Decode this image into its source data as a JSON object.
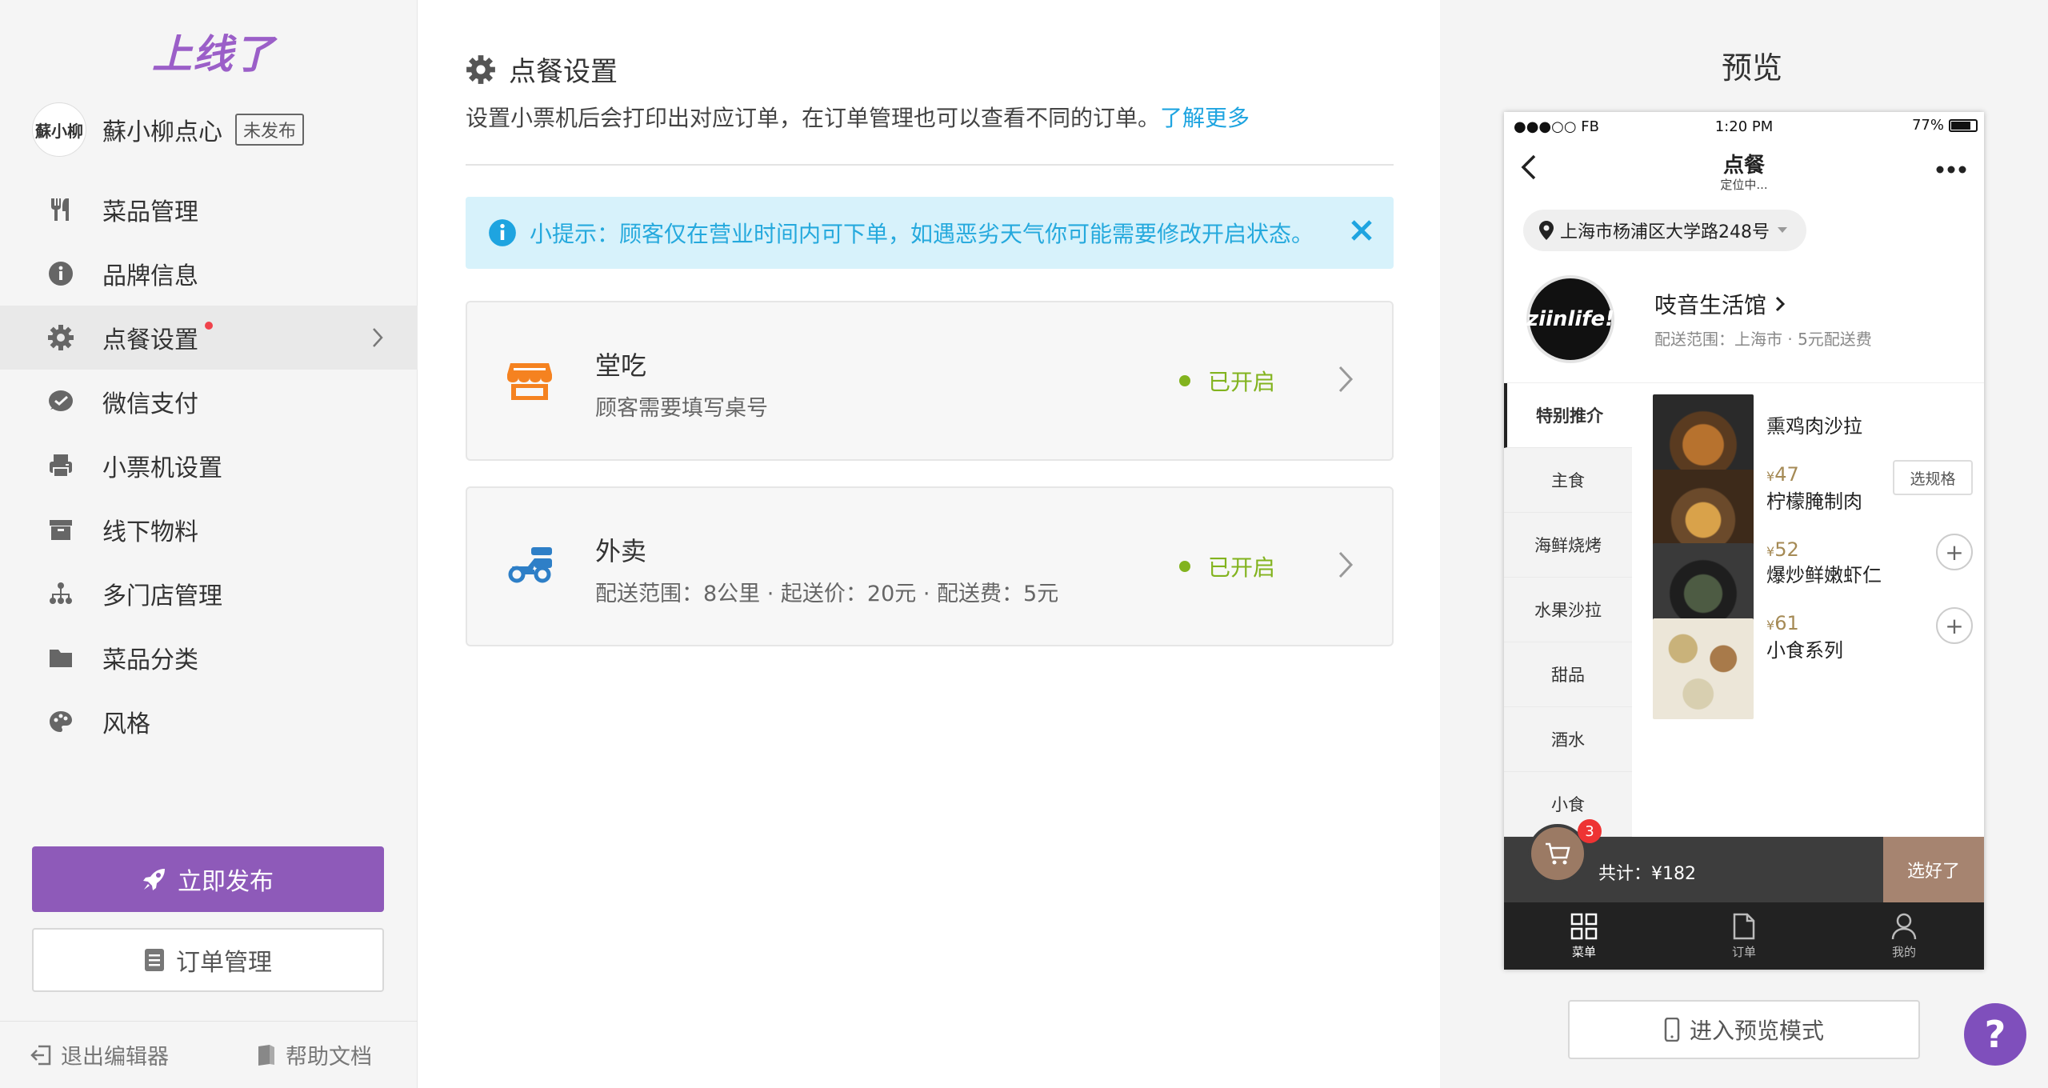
{
  "app": {
    "logo_text": "上线了"
  },
  "store": {
    "avatar_text": "蘇小柳",
    "name": "蘇小柳点心",
    "status_badge": "未发布"
  },
  "sidebar": {
    "items": [
      {
        "label": "菜品管理",
        "icon": "utensils-icon"
      },
      {
        "label": "品牌信息",
        "icon": "info-icon"
      },
      {
        "label": "点餐设置",
        "icon": "gear-icon",
        "active": true,
        "has_dot": true
      },
      {
        "label": "微信支付",
        "icon": "wechat-pay-icon"
      },
      {
        "label": "小票机设置",
        "icon": "printer-icon"
      },
      {
        "label": "线下物料",
        "icon": "archive-icon"
      },
      {
        "label": "多门店管理",
        "icon": "sitemap-icon"
      },
      {
        "label": "菜品分类",
        "icon": "folder-icon"
      },
      {
        "label": "风格",
        "icon": "palette-icon"
      }
    ],
    "publish_label": "立即发布",
    "orders_label": "订单管理",
    "exit_label": "退出编辑器",
    "help_label": "帮助文档"
  },
  "main": {
    "title": "点餐设置",
    "description": "设置小票机后会打印出对应订单，在订单管理也可以查看不同的订单。",
    "learn_more": "了解更多",
    "tip": "小提示：顾客仅在营业时间内可下单，如遇恶劣天气你可能需要修改开启状态。",
    "cards": [
      {
        "title": "堂吃",
        "subtitle": "顾客需要填写桌号",
        "status": "已开启",
        "icon": "store-icon"
      },
      {
        "title": "外卖",
        "subtitle": "配送范围：8公里 · 起送价：20元 · 配送费：5元",
        "status": "已开启",
        "icon": "scooter-icon"
      }
    ]
  },
  "preview": {
    "title": "预览",
    "statusbar": {
      "carrier": "●●●○○ FB",
      "time": "1:20 PM",
      "battery": "77%"
    },
    "nav_title": "点餐",
    "nav_subtitle": "定位中...",
    "address": "上海市杨浦区大学路248号",
    "shop": {
      "logo_text": "ziinlife!",
      "name": "吱音生活馆",
      "subtitle": "配送范围：上海市 · 5元配送费"
    },
    "categories": [
      "特别推介",
      "主食",
      "海鲜烧烤",
      "水果沙拉",
      "甜品",
      "酒水",
      "小食"
    ],
    "dishes": [
      {
        "name": "熏鸡肉沙拉",
        "currency": "¥",
        "price": "47",
        "action": "选规格"
      },
      {
        "name": "柠檬腌制肉",
        "currency": "¥",
        "price": "52",
        "action": "+"
      },
      {
        "name": "爆炒鲜嫩虾仁",
        "currency": "¥",
        "price": "61",
        "action": "+"
      },
      {
        "name": "小食系列",
        "currency": "",
        "price": "",
        "action": ""
      }
    ],
    "cart": {
      "count": "3",
      "total": "共计：¥182",
      "checkout": "选好了"
    },
    "tabs": [
      {
        "label": "菜单"
      },
      {
        "label": "订单"
      },
      {
        "label": "我的"
      }
    ],
    "enter_preview": "进入预览模式"
  },
  "colors": {
    "brand": "#8e5ab9",
    "accent": "#1ea4e0",
    "status_on": "#82b31e",
    "danger": "#f0434c"
  }
}
